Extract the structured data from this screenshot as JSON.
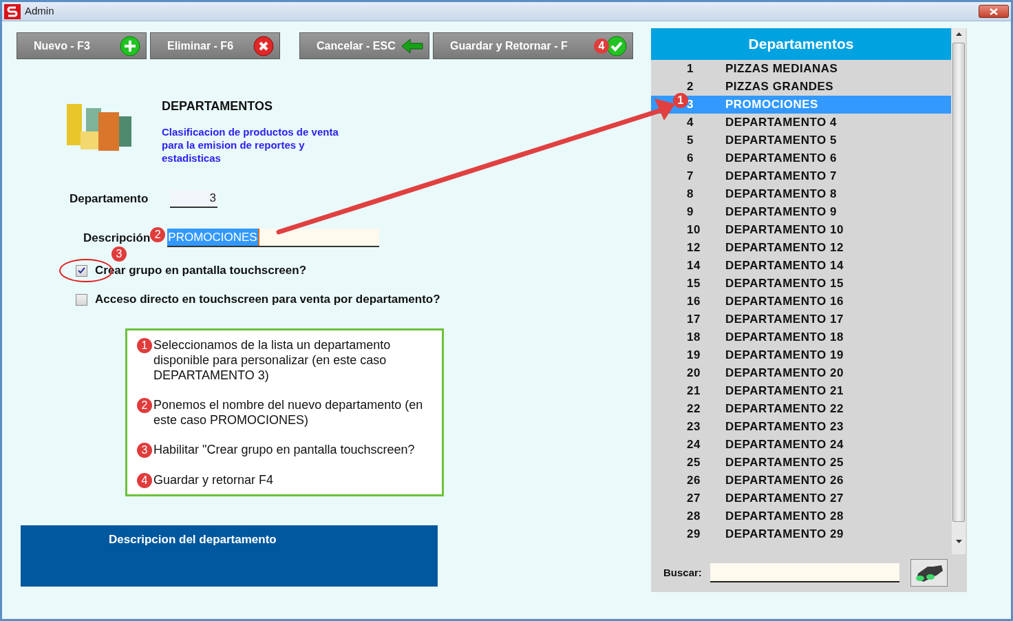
{
  "window": {
    "title": "Admin"
  },
  "toolbar": [
    {
      "label": "Nuevo - F3",
      "kind": "add"
    },
    {
      "label": "Eliminar - F6",
      "kind": "delete"
    },
    {
      "label": "Cancelar - ESC",
      "kind": "back"
    },
    {
      "label": "Guardar y Retornar - F",
      "kind": "save",
      "badge": "4"
    }
  ],
  "header": {
    "title": "DEPARTAMENTOS",
    "description": "Clasificacion de productos de venta para la emision de reportes y estadisticas"
  },
  "department_field": {
    "label": "Departamento",
    "value": "3"
  },
  "description_field": {
    "label": "Descripción",
    "value": "PROMOCIONES",
    "badge": "2"
  },
  "checkboxes": [
    {
      "label": "Crear grupo en pantalla touchscreen?",
      "checked": true,
      "badge": "3"
    },
    {
      "label": "Acceso directo en touchscreen para venta por departamento?",
      "checked": false
    }
  ],
  "instructions": [
    {
      "number": "1",
      "text": "Seleccionamos de la lista un departamento disponible para personalizar (en este caso DEPARTAMENTO 3)"
    },
    {
      "number": "2",
      "text": "Ponemos el nombre del nuevo departamento (en este caso PROMOCIONES)"
    },
    {
      "number": "3",
      "text": "Habilitar \"Crear grupo en pantalla touchscreen?"
    },
    {
      "number": "4",
      "text": "Guardar y retornar F4"
    }
  ],
  "description_panel": {
    "title": "Descripcion del departamento"
  },
  "list": {
    "title": "Departamentos",
    "rows": [
      {
        "id": "1",
        "name": "PIZZAS MEDIANAS",
        "selected": false
      },
      {
        "id": "2",
        "name": "PIZZAS GRANDES",
        "selected": false
      },
      {
        "id": "3",
        "name": "PROMOCIONES",
        "selected": true,
        "badge": "1"
      },
      {
        "id": "4",
        "name": "DEPARTAMENTO 4",
        "selected": false
      },
      {
        "id": "5",
        "name": "DEPARTAMENTO 5",
        "selected": false
      },
      {
        "id": "6",
        "name": "DEPARTAMENTO 6",
        "selected": false
      },
      {
        "id": "7",
        "name": "DEPARTAMENTO 7",
        "selected": false
      },
      {
        "id": "8",
        "name": "DEPARTAMENTO 8",
        "selected": false
      },
      {
        "id": "9",
        "name": "DEPARTAMENTO 9",
        "selected": false
      },
      {
        "id": "10",
        "name": "DEPARTAMENTO 10",
        "selected": false
      },
      {
        "id": "12",
        "name": "DEPARTAMENTO 12",
        "selected": false
      },
      {
        "id": "14",
        "name": "DEPARTAMENTO 14",
        "selected": false
      },
      {
        "id": "15",
        "name": "DEPARTAMENTO 15",
        "selected": false
      },
      {
        "id": "16",
        "name": "DEPARTAMENTO 16",
        "selected": false
      },
      {
        "id": "17",
        "name": "DEPARTAMENTO 17",
        "selected": false
      },
      {
        "id": "18",
        "name": "DEPARTAMENTO 18",
        "selected": false
      },
      {
        "id": "19",
        "name": "DEPARTAMENTO 19",
        "selected": false
      },
      {
        "id": "20",
        "name": "DEPARTAMENTO 20",
        "selected": false
      },
      {
        "id": "21",
        "name": "DEPARTAMENTO 21",
        "selected": false
      },
      {
        "id": "22",
        "name": "DEPARTAMENTO 22",
        "selected": false
      },
      {
        "id": "23",
        "name": "DEPARTAMENTO 23",
        "selected": false
      },
      {
        "id": "24",
        "name": "DEPARTAMENTO 24",
        "selected": false
      },
      {
        "id": "25",
        "name": "DEPARTAMENTO 25",
        "selected": false
      },
      {
        "id": "26",
        "name": "DEPARTAMENTO 26",
        "selected": false
      },
      {
        "id": "27",
        "name": "DEPARTAMENTO 27",
        "selected": false
      },
      {
        "id": "28",
        "name": "DEPARTAMENTO 28",
        "selected": false
      },
      {
        "id": "29",
        "name": "DEPARTAMENTO 29",
        "selected": false
      }
    ]
  },
  "search": {
    "label": "Buscar:"
  }
}
